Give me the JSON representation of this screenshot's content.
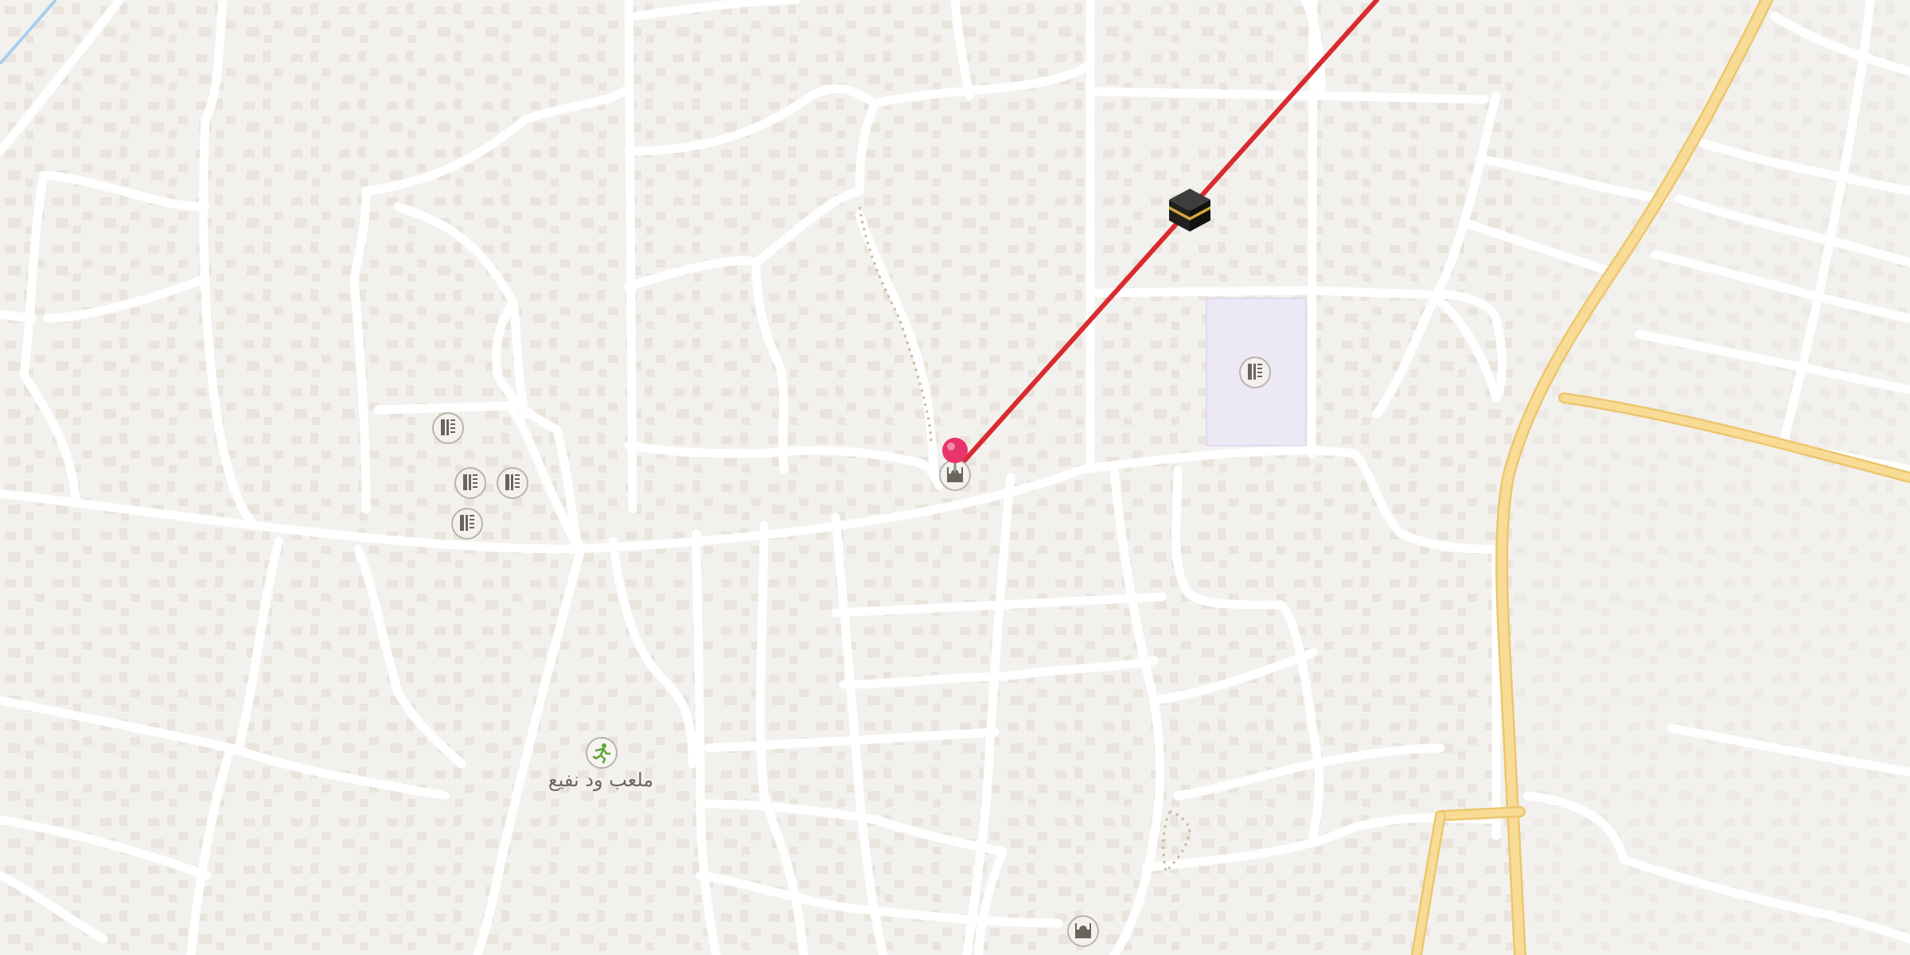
{
  "map": {
    "type": "street-map",
    "colors": {
      "land": "#f3f1ee",
      "road": "#ffffff",
      "road_edge": "#e2ded8",
      "major_road": "#f8dc96",
      "major_road_edge": "#ecc66e",
      "building": "#e9e3dc",
      "route_line": "#d92b2f",
      "school_area": "#ece8f6",
      "pin": "#e8336b",
      "water": "#a9cdef"
    },
    "labels": {
      "playground": "ملعب ود نفيع"
    },
    "pois": [
      {
        "id": "poi-school-1",
        "icon": "school-icon"
      },
      {
        "id": "poi-school-2",
        "icon": "school-icon"
      },
      {
        "id": "poi-school-3",
        "icon": "school-icon"
      },
      {
        "id": "poi-school-4",
        "icon": "school-icon"
      },
      {
        "id": "poi-school-5",
        "icon": "school-icon"
      },
      {
        "id": "poi-mosque-1",
        "icon": "mosque-icon"
      },
      {
        "id": "poi-mosque-2",
        "icon": "mosque-icon"
      },
      {
        "id": "poi-sports",
        "icon": "running-person-icon"
      },
      {
        "id": "poi-kaaba",
        "icon": "kaaba-icon"
      },
      {
        "id": "dropped-pin",
        "icon": "pin-icon"
      }
    ]
  }
}
